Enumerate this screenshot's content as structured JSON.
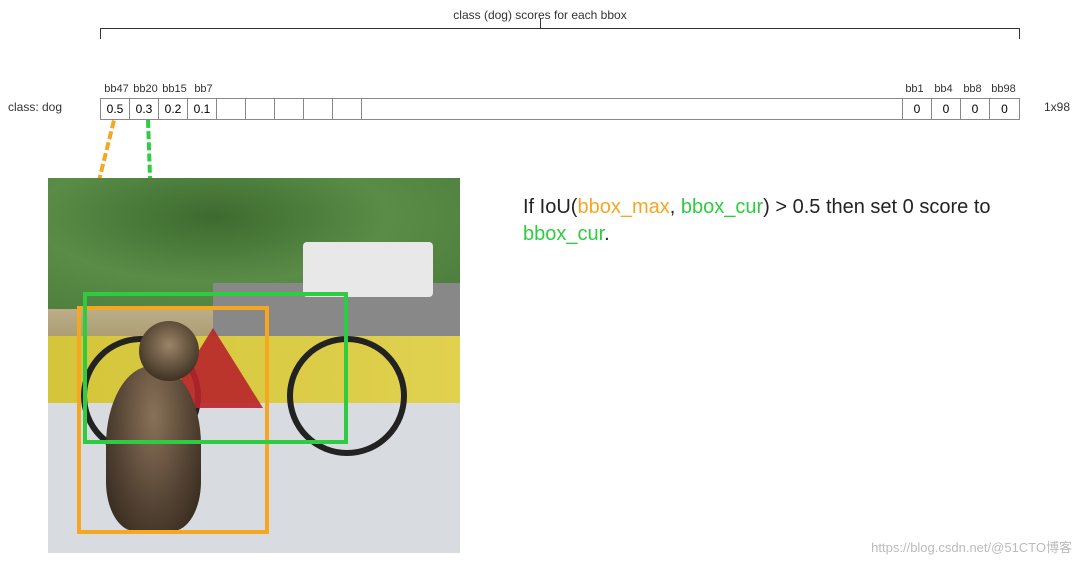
{
  "title": "class (dog) scores for each bbox",
  "class_label": "class: dog",
  "dim_label": "1x98",
  "top_labels_left": [
    "bb47",
    "bb20",
    "bb15",
    "bb7"
  ],
  "top_labels_right": [
    "bb1",
    "bb4",
    "bb8",
    "bb98"
  ],
  "score_values_left": [
    "0.5",
    "0.3",
    "0.2",
    "0.1"
  ],
  "blank_narrow_count": 5,
  "score_values_right": [
    "0",
    "0",
    "0",
    "0"
  ],
  "explain": {
    "pre": "If IoU(",
    "bbox_max": "bbox_max",
    "sep1": ", ",
    "bbox_cur": "bbox_cur",
    "mid": ") > 0.5 then set 0 score to ",
    "bbox_cur2": "bbox_cur",
    "end": "."
  },
  "colors": {
    "orange": "#f5a623",
    "green": "#2ecc40"
  },
  "watermark": "https://blog.csdn.net/@51CTO博客"
}
